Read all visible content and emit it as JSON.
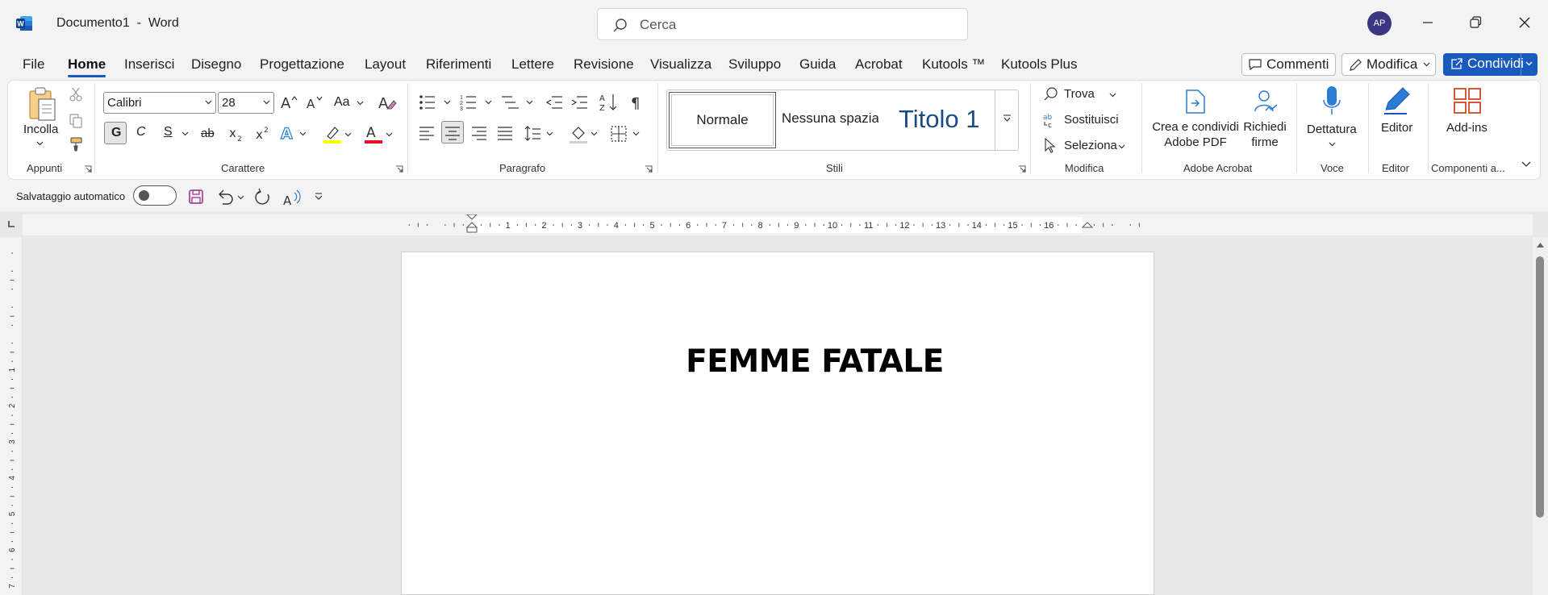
{
  "window": {
    "app_title": "Documento1  -  Word",
    "search_placeholder": "Cerca",
    "user_initials": "AP"
  },
  "menu": {
    "tabs": [
      "File",
      "Home",
      "Inserisci",
      "Disegno",
      "Progettazione",
      "Layout",
      "Riferimenti",
      "Lettere",
      "Revisione",
      "Visualizza",
      "Sviluppo",
      "Guida",
      "Acrobat",
      "Kutools ™",
      "Kutools Plus"
    ],
    "active_tab": "Home",
    "comments_label": "Commenti",
    "edit_mode_label": "Modifica",
    "share_label": "Condividi"
  },
  "ribbon": {
    "clipboard": {
      "paste_label": "Incolla",
      "group_label": "Appunti"
    },
    "font": {
      "font_name": "Calibri",
      "font_size": "28",
      "bold_label": "G",
      "italic_label": "C",
      "underline_label": "S",
      "strike_label": "ab",
      "change_case_label": "Aa",
      "group_label": "Carattere"
    },
    "paragraph": {
      "group_label": "Paragrafo"
    },
    "styles": {
      "items": [
        "Normale",
        "Nessuna spazia",
        "Titolo 1"
      ],
      "group_label": "Stili"
    },
    "editing": {
      "find_label": "Trova",
      "replace_label": "Sostituisci",
      "select_label": "Seleziona",
      "group_label": "Modifica"
    },
    "acrobat": {
      "create_pdf_line1": "Crea e condividi",
      "create_pdf_line2": "Adobe PDF",
      "request_sign_line1": "Richiedi",
      "request_sign_line2": "firme",
      "group_label": "Adobe Acrobat"
    },
    "voice": {
      "dictate_label": "Dettatura",
      "group_label": "Voce"
    },
    "editor": {
      "editor_label": "Editor",
      "group_label": "Editor"
    },
    "addins": {
      "addins_label": "Add-ins",
      "group_label": "Componenti a..."
    }
  },
  "quick_access": {
    "autosave_label": "Salvataggio automatico",
    "autosave_on": false
  },
  "ruler": {
    "h_numbers": [
      "1",
      "2",
      "3",
      "4",
      "5",
      "6",
      "7",
      "8",
      "9",
      "10",
      "11",
      "12",
      "13",
      "14",
      "15",
      "16"
    ],
    "v_numbers": [
      "1",
      "2",
      "3",
      "4",
      "5",
      "6",
      "7"
    ]
  },
  "document": {
    "heading": "FEMME FATALE"
  },
  "colors": {
    "accent": "#185abd",
    "avatar_bg": "#3b3782",
    "highlight": "#ffff00",
    "font_color": "#e81123",
    "title_style": "#1b4b87"
  }
}
